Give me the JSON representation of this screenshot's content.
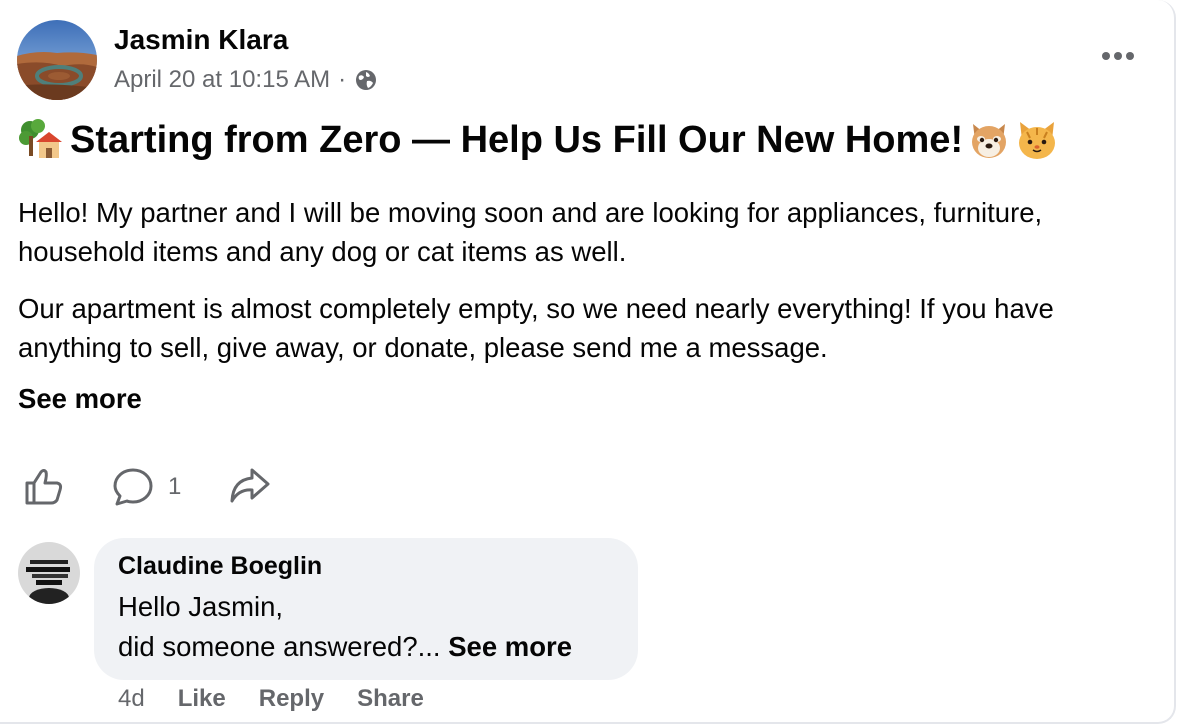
{
  "post": {
    "author": "Jasmin Klara",
    "timestamp": "April 20 at 10:15 AM",
    "separator": "·",
    "audience_icon": "globe-icon",
    "title": "Starting from Zero — Help Us Fill Our New Home!",
    "title_emoji_before": "tree-house-emoji",
    "title_emoji_after": [
      "dog-face-emoji",
      "cat-face-emoji"
    ],
    "paragraphs": [
      "Hello! My partner and I will be moving soon and are looking for appliances, furniture, household items and any dog or cat items as well.",
      "Our apartment is almost completely empty, so we need nearly everything! If you have anything to sell, give away, or donate, please send me a message."
    ],
    "see_more": "See more"
  },
  "actions": {
    "comment_count": "1",
    "icons": [
      "thumbs-up-icon",
      "comment-icon",
      "share-icon"
    ]
  },
  "comment": {
    "author": "Claudine Boeglin",
    "line1": "Hello Jasmin,",
    "line2": "did someone answered?...",
    "see_more": "See more",
    "age": "4d",
    "like": "Like",
    "reply": "Reply",
    "share": "Share"
  },
  "colors": {
    "primary_text": "#050505",
    "secondary_text": "#65676b",
    "bubble": "#f0f2f5"
  }
}
